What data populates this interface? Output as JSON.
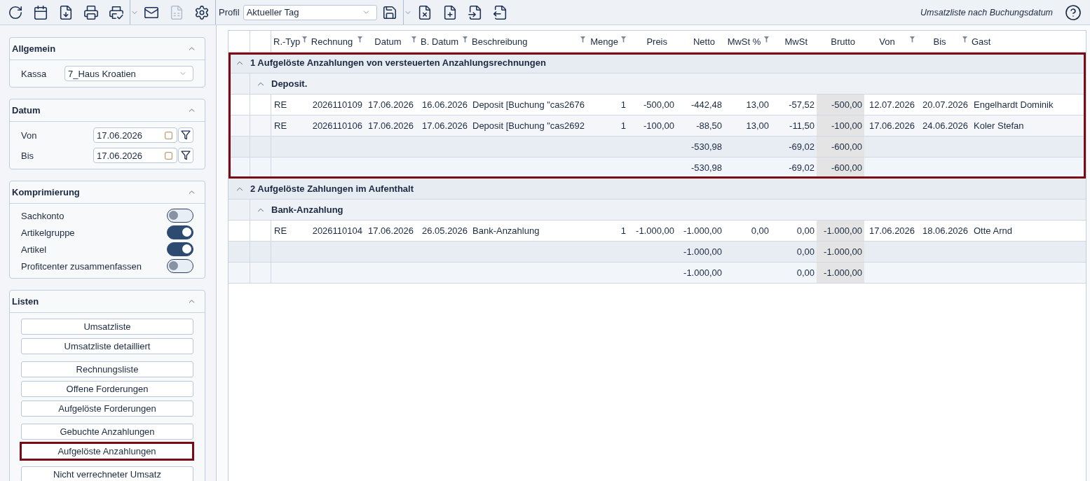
{
  "toolbar": {
    "buttons": [
      {
        "disabled": false
      },
      {
        "disabled": false
      },
      {
        "disabled": false
      },
      {
        "disabled": false
      },
      {
        "disabled": false
      },
      {
        "disabled": false
      },
      {
        "disabled": true
      },
      {
        "disabled": false
      }
    ],
    "profile": {
      "label": "Profil",
      "value": "Aktueller Tag"
    },
    "file_buttons": [
      {
        "disabled": false
      },
      {
        "disabled": false
      },
      {
        "disabled": false
      },
      {
        "disabled": false
      },
      {
        "disabled": false
      }
    ],
    "title": "Umsatzliste nach Buchungsdatum"
  },
  "sidebar": {
    "panels": [
      {
        "kind": "select",
        "title": "Allgemein",
        "expanded": true,
        "fields": [
          {
            "label": "Kassa",
            "value": "7_Haus Kroatien"
          }
        ]
      },
      {
        "kind": "dates",
        "title": "Datum",
        "expanded": true,
        "fields": [
          {
            "label": "Von",
            "value": "17.06.2026"
          },
          {
            "label": "Bis",
            "value": "17.06.2026"
          }
        ]
      },
      {
        "kind": "toggles",
        "title": "Komprimierung",
        "expanded": true,
        "toggles": [
          {
            "label": "Sachkonto",
            "on": false
          },
          {
            "label": "Artikelgruppe",
            "on": true
          },
          {
            "label": "Artikel",
            "on": true
          },
          {
            "label": "Profitcenter zusammenfassen",
            "on": false
          }
        ]
      },
      {
        "kind": "lists",
        "title": "Listen",
        "expanded": true,
        "button_groups": [
          {
            "buttons": [
              {
                "label": "Umsatzliste",
                "selected": false
              },
              {
                "label": "Umsatzliste detailliert",
                "selected": false
              }
            ]
          },
          {
            "buttons": [
              {
                "label": "Rechnungsliste",
                "selected": false
              },
              {
                "label": "Offene Forderungen",
                "selected": false
              },
              {
                "label": "Aufgelöste Forderungen",
                "selected": false
              }
            ]
          },
          {
            "buttons": [
              {
                "label": "Gebuchte Anzahlungen",
                "selected": false
              },
              {
                "label": "Aufgelöste Anzahlungen",
                "selected": true
              }
            ]
          },
          {
            "buttons": [
              {
                "label": "Nicht verrechneter Umsatz",
                "selected": false
              }
            ]
          }
        ]
      }
    ]
  },
  "table": {
    "columns": [
      {
        "label": "R.-Typ",
        "filter": true
      },
      {
        "label": "Rechnung",
        "filter": true
      },
      {
        "label": "Datum",
        "filter": true
      },
      {
        "label": "B. Datum",
        "filter": true
      },
      {
        "label": "Beschreibung",
        "filter": true
      },
      {
        "label": "Menge",
        "filter": true
      },
      {
        "label": "Preis",
        "filter": false
      },
      {
        "label": "Netto",
        "filter": false
      },
      {
        "label": "MwSt %",
        "filter": true
      },
      {
        "label": "MwSt",
        "filter": false
      },
      {
        "label": "Brutto",
        "filter": false
      },
      {
        "label": "Von",
        "filter": true
      },
      {
        "label": "Bis",
        "filter": true
      },
      {
        "label": "Gast",
        "filter": false
      }
    ],
    "groups": [
      {
        "title": "1 Aufgelöste Anzahlungen von versteuerten Anzahlungsrechnungen",
        "expanded": true,
        "highlighted": true,
        "children": [
          {
            "title": "Deposit.",
            "expanded": true,
            "rows": [
              [
                "RE",
                "2026110109",
                "17.06.2026",
                "16.06.2026",
                "Deposit [Buchung \"cas2676",
                "1",
                "-500,00",
                "-442,48",
                "13,00",
                "-57,52",
                "-500,00",
                "12.07.2026",
                "20.07.2026",
                "Engelhardt Dominik"
              ],
              [
                "RE",
                "2026110106",
                "17.06.2026",
                "17.06.2026",
                "Deposit [Buchung \"cas2692",
                "1",
                "-100,00",
                "-88,50",
                "13,00",
                "-11,50",
                "-100,00",
                "17.06.2026",
                "24.06.2026",
                "Koler Stefan"
              ]
            ],
            "sum": {
              "netto": "-530,98",
              "mwst": "-69,02",
              "brutto": "-600,00"
            }
          }
        ],
        "sum": {
          "netto": "-530,98",
          "mwst": "-69,02",
          "brutto": "-600,00"
        }
      },
      {
        "title": "2 Aufgelöste Zahlungen im Aufenthalt",
        "expanded": true,
        "highlighted": false,
        "children": [
          {
            "title": "Bank-Anzahlung",
            "expanded": true,
            "rows": [
              [
                "RE",
                "2026110104",
                "17.06.2026",
                "26.05.2026",
                "Bank-Anzahlung",
                "1",
                "-1.000,00",
                "-1.000,00",
                "0,00",
                "0,00",
                "-1.000,00",
                "17.06.2026",
                "18.06.2026",
                "Otte Arnd"
              ]
            ],
            "sum": {
              "netto": "-1.000,00",
              "mwst": "0,00",
              "brutto": "-1.000,00"
            }
          }
        ],
        "sum": {
          "netto": "-1.000,00",
          "mwst": "0,00",
          "brutto": "-1.000,00"
        }
      }
    ]
  }
}
